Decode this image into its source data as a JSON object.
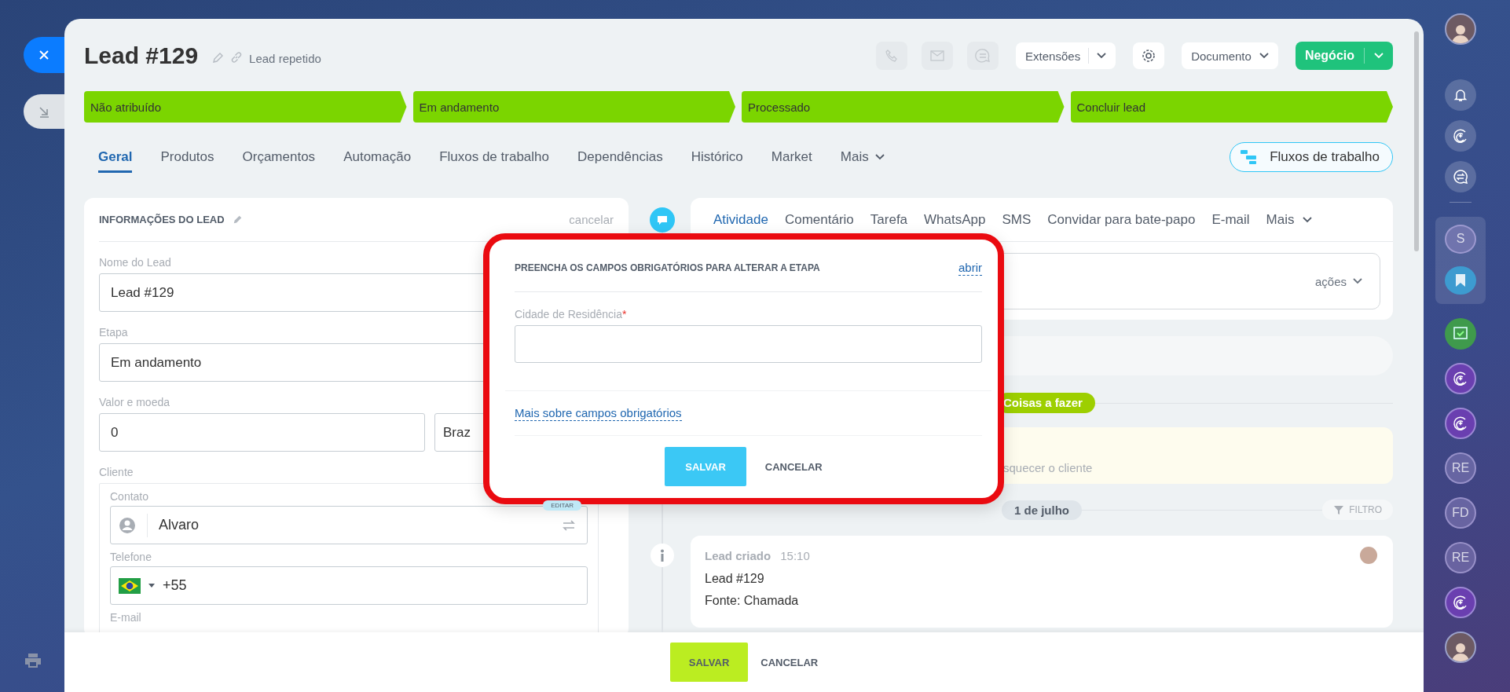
{
  "header": {
    "title": "Lead #129",
    "subtitle": "Lead repetido"
  },
  "toolbar": {
    "extensions": "Extensões",
    "document": "Documento",
    "convert": "Negócio"
  },
  "stages": [
    {
      "label": "Não atribuído",
      "filled": true
    },
    {
      "label": "Em andamento",
      "filled": true
    },
    {
      "label": "Processado",
      "filled": true
    },
    {
      "label": "Concluir lead",
      "filled": true
    }
  ],
  "tabs": [
    {
      "label": "Geral",
      "selected": true,
      "kind": "plain"
    },
    {
      "label": "Produtos",
      "selected": false,
      "kind": "plain"
    },
    {
      "label": "Orçamentos",
      "selected": false,
      "kind": "plain"
    },
    {
      "label": "Automação",
      "selected": false,
      "kind": "plain"
    },
    {
      "label": "Fluxos de trabalho",
      "selected": false,
      "kind": "plain"
    },
    {
      "label": "Dependências",
      "selected": false,
      "kind": "plain"
    },
    {
      "label": "Histórico",
      "selected": false,
      "kind": "plain"
    },
    {
      "label": "Market",
      "selected": false,
      "kind": "plain"
    },
    {
      "label": "Mais",
      "selected": false,
      "kind": "dropdown"
    }
  ],
  "workflows_button": "Fluxos de trabalho",
  "lead_info": {
    "title": "INFORMAÇÕES DO LEAD",
    "cancel": "cancelar",
    "fields": [
      {
        "label": "Nome do Lead",
        "value": "Lead #129"
      },
      {
        "label": "Etapa",
        "value": "Em andamento"
      }
    ],
    "amount": {
      "label": "Valor e moeda",
      "value": "0",
      "currency": "Braz"
    },
    "client": {
      "label": "Cliente",
      "contact_label": "Contato",
      "contact": "Alvaro",
      "edit_badge": "EDITAR",
      "phone_label": "Telefone",
      "phone": "+55",
      "email_label": "E-mail"
    }
  },
  "activity": {
    "tabs": [
      {
        "label": "Atividade",
        "selected": true,
        "kind": "plain"
      },
      {
        "label": "Comentário",
        "selected": false,
        "kind": "plain"
      },
      {
        "label": "Tarefa",
        "selected": false,
        "kind": "plain"
      },
      {
        "label": "WhatsApp",
        "selected": false,
        "kind": "plain"
      },
      {
        "label": "SMS",
        "selected": false,
        "kind": "plain"
      },
      {
        "label": "Convidar para bate-papo",
        "selected": false,
        "kind": "plain"
      },
      {
        "label": "E-mail",
        "selected": false,
        "kind": "plain"
      },
      {
        "label": "Mais",
        "selected": false,
        "kind": "dropdown"
      }
    ],
    "actions": "ações",
    "todo_badge": "Coisas a fazer",
    "reminder": "squecer o cliente",
    "date": "1 de julho",
    "filter": "FILTRO",
    "event": {
      "title": "Lead criado",
      "time": "15:10",
      "lines": [
        "Lead #129",
        "Fonte: Chamada"
      ]
    }
  },
  "modal": {
    "title": "PREENCHA OS CAMPOS OBRIGATÓRIOS PARA ALTERAR A ETAPA",
    "open_link": "abrir",
    "field_label": "Cidade de Residência",
    "required_mark": "*",
    "help_link": "Mais sobre campos obrigatórios",
    "save": "SALVAR",
    "cancel": "CANCELAR"
  },
  "footer": {
    "save": "SALVAR",
    "cancel": "CANCELAR"
  },
  "rail": {
    "top": [
      {
        "kind": "avatar"
      },
      {
        "kind": "bell"
      },
      {
        "kind": "copilot"
      },
      {
        "kind": "chat"
      }
    ],
    "pinned": [
      {
        "kind": "initials",
        "text": "S"
      },
      {
        "kind": "bookmark"
      }
    ],
    "items": [
      {
        "kind": "task"
      },
      {
        "kind": "copilot-purple"
      },
      {
        "kind": "copilot-purple"
      },
      {
        "kind": "initials",
        "text": "RE"
      },
      {
        "kind": "initials",
        "text": "FD"
      },
      {
        "kind": "initials",
        "text": "RE"
      },
      {
        "kind": "copilot-purple"
      },
      {
        "kind": "avatar"
      }
    ]
  }
}
